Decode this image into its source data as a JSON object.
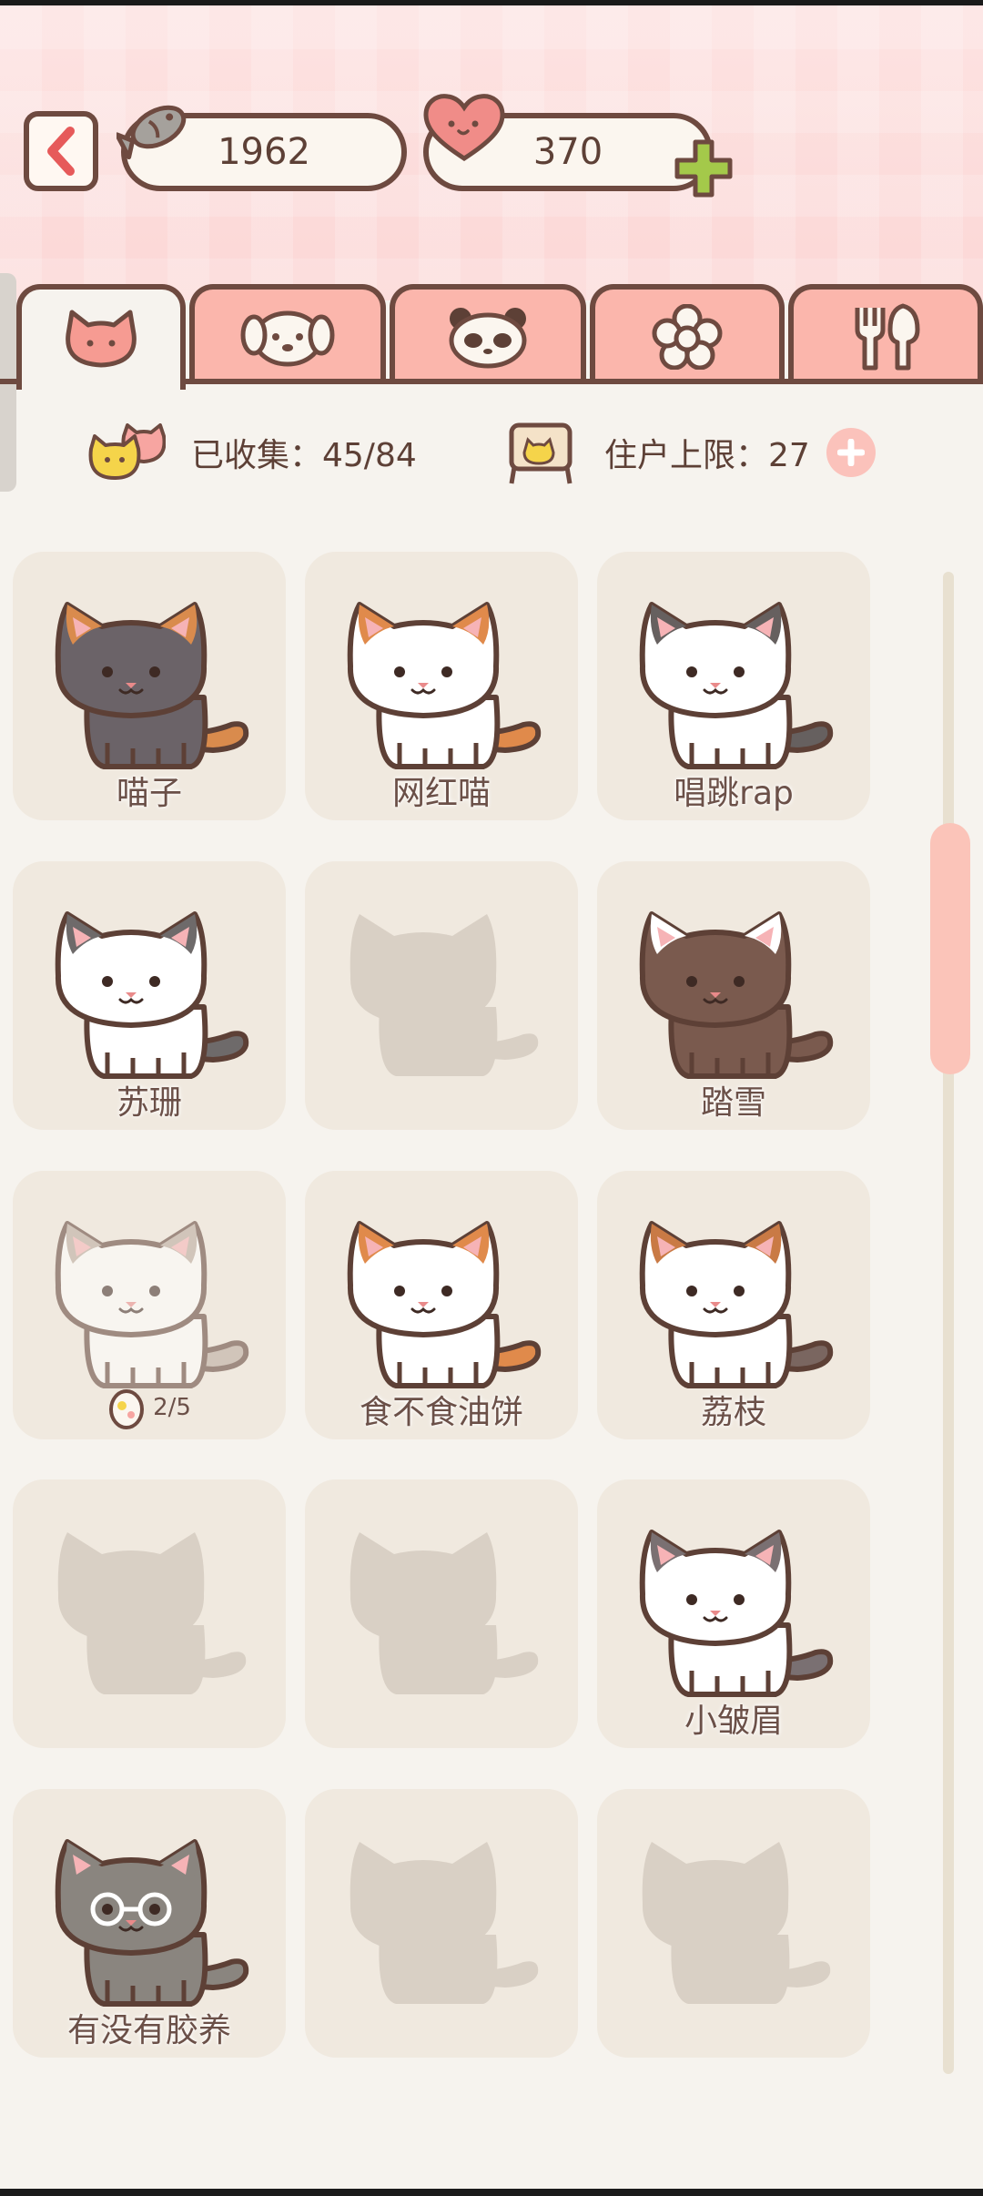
{
  "currency": {
    "fish": "1962",
    "hearts": "370"
  },
  "tabs": [
    {
      "name": "cat-tab",
      "icon": "cat-face-icon",
      "active": true
    },
    {
      "name": "dog-tab",
      "icon": "dog-face-icon",
      "active": false
    },
    {
      "name": "panda-tab",
      "icon": "panda-face-icon",
      "active": false
    },
    {
      "name": "flower-tab",
      "icon": "flower-icon",
      "active": false
    },
    {
      "name": "food-tab",
      "icon": "fork-spoon-icon",
      "active": false
    }
  ],
  "stats": {
    "collected_label": "已收集：45/84",
    "limit_label": "住户上限：27"
  },
  "cats": [
    {
      "name": "喵子",
      "state": "owned",
      "body": "#6b6368",
      "patch": "#d98b4d",
      "tail": "#d98b4d"
    },
    {
      "name": "网红喵",
      "state": "owned",
      "body": "#ffffff",
      "patch": "#e08a4b",
      "tail": "#e08a4b"
    },
    {
      "name": "唱跳rap",
      "state": "owned",
      "body": "#ffffff",
      "patch": "#66605f",
      "tail": "#66605f"
    },
    {
      "name": "苏珊",
      "state": "owned",
      "body": "#ffffff",
      "patch": "#6e6a6a",
      "tail": "#6e6a6a"
    },
    {
      "name": "",
      "state": "locked"
    },
    {
      "name": "踏雪",
      "state": "owned",
      "body": "#7a5a4e",
      "patch": "#ffffff",
      "tail": "#7a5a4e"
    },
    {
      "name": "",
      "state": "egg",
      "egg_progress": "2/5",
      "body": "#ffffff",
      "patch": "#b9a99c",
      "tail": "#b9a99c"
    },
    {
      "name": "食不食油饼",
      "state": "owned",
      "body": "#ffffff",
      "patch": "#e08a4b",
      "tail": "#e08a4b"
    },
    {
      "name": "荔枝",
      "state": "owned",
      "body": "#ffffff",
      "patch": "#c97a45",
      "tail": "#7a6660"
    },
    {
      "name": "",
      "state": "locked"
    },
    {
      "name": "",
      "state": "locked"
    },
    {
      "name": "小皱眉",
      "state": "owned",
      "body": "#ffffff",
      "patch": "#7a7072",
      "tail": "#7a7072"
    },
    {
      "name": "有没有胶养",
      "state": "owned",
      "body": "#8a857f",
      "patch": "#8a857f",
      "tail": "#8a857f",
      "glasses": true
    },
    {
      "name": "",
      "state": "locked"
    },
    {
      "name": "",
      "state": "locked"
    }
  ],
  "colors": {
    "accent": "#fbb6ac",
    "outline": "#6e4a40",
    "card": "#f0e9df",
    "background": "#f6f3ee"
  }
}
